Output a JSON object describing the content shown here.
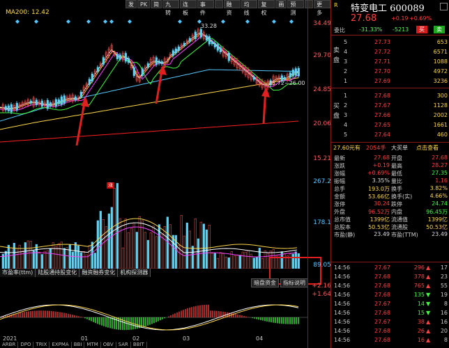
{
  "toolbar": {
    "buttons": [
      "发",
      "PK",
      "简",
      "九转",
      "连板",
      "事件",
      "",
      "融资",
      "均线",
      "复权",
      "画",
      "预测",
      "",
      "更多"
    ]
  },
  "chart": {
    "ma_label": "MA200: 12.42",
    "peak_label": "33.28",
    "range_label": "25.72~26.00",
    "zhang_badge": "涨",
    "price_ticks": [
      "34.49",
      "29.70",
      "24.85",
      "20.06",
      "15.21"
    ],
    "volume_ticks": [
      "267.2",
      "178.1",
      "89.05"
    ],
    "macd_ticks": [
      "+2.16",
      "+1.64"
    ],
    "indicator_tabs": [
      "市盈率(ttm)",
      "陆股通持股变化",
      "融资融券变化",
      "机构探测器"
    ],
    "sub_buttons": [
      "暗盘资金",
      "指标说明"
    ],
    "bottom_tabs": [
      "ARBR",
      "DPO",
      "TRIX",
      "EXPMA",
      "BBI",
      "MTM",
      "OBV",
      "SAR",
      "BBIT"
    ],
    "months": [
      "2021",
      "01",
      "02",
      "03",
      "04"
    ],
    "colors": {
      "up": "#ff4040",
      "down": "#4fd8ff",
      "ma5": "#ffffff",
      "ma10": "#ffd84a",
      "ma20": "#ff40ff",
      "ma60": "#40ff40",
      "ma200": "#ff2020"
    }
  },
  "quote": {
    "market_tag": "R",
    "name": "特变电工 600089",
    "price": "27.68",
    "change": "+0.19",
    "change_pct": "+0.69%",
    "weibi_label": "委比",
    "weibi": "-31.33%",
    "weicha": "-5213",
    "buy_btn": "买",
    "sell_btn": "卖",
    "ask_side": "卖盘",
    "bid_side": "买盘",
    "asks": [
      {
        "level": "5",
        "price": "27.73",
        "vol": "653"
      },
      {
        "level": "4",
        "price": "27.72",
        "vol": "6571"
      },
      {
        "level": "3",
        "price": "27.71",
        "vol": "1088"
      },
      {
        "level": "2",
        "price": "27.70",
        "vol": "4972"
      },
      {
        "level": "1",
        "price": "27.69",
        "vol": "3236"
      }
    ],
    "bids": [
      {
        "level": "1",
        "price": "27.68",
        "vol": "300"
      },
      {
        "level": "2",
        "price": "27.67",
        "vol": "1128"
      },
      {
        "level": "3",
        "price": "27.66",
        "vol": "2002"
      },
      {
        "level": "4",
        "price": "27.65",
        "vol": "1661"
      },
      {
        "level": "5",
        "price": "27.64",
        "vol": "460"
      }
    ],
    "links": {
      "last": "27.60元有",
      "vol": "2054手",
      "big": "大买单",
      "click": "点击查看"
    },
    "stats": [
      {
        "k1": "最新",
        "v1": "27.68",
        "c1": "red",
        "k2": "开盘",
        "v2": "27.68",
        "c2": "red"
      },
      {
        "k1": "涨跌",
        "v1": "+0.19",
        "c1": "red",
        "k2": "最高",
        "v2": "28.27",
        "c2": "red"
      },
      {
        "k1": "涨幅",
        "v1": "+0.69%",
        "c1": "red",
        "k2": "最低",
        "v2": "27.35",
        "c2": "grn"
      },
      {
        "k1": "振幅",
        "v1": "3.35%",
        "c1": "wht",
        "k2": "量比",
        "v2": "1.16",
        "c2": "red"
      },
      {
        "k1": "总手",
        "v1": "193.0万",
        "c1": "yel",
        "k2": "换手",
        "v2": "3.82%",
        "c2": "yel"
      },
      {
        "k1": "金额",
        "v1": "53.66亿",
        "c1": "yel",
        "k2": "换手(实)",
        "v2": "4.66%",
        "c2": "yel"
      },
      {
        "k1": "涨停",
        "v1": "30.24",
        "c1": "red",
        "k2": "跌停",
        "v2": "24.74",
        "c2": "grn"
      },
      {
        "k1": "外盘",
        "v1": "96.52万",
        "c1": "red",
        "k2": "内盘",
        "v2": "96.45万",
        "c2": "grn"
      },
      {
        "k1": "总市值",
        "v1": "1399亿",
        "c1": "yel",
        "k2": "流通值",
        "v2": "1399亿",
        "c2": "yel"
      },
      {
        "k1": "总股本",
        "v1": "50.53亿",
        "c1": "yel",
        "k2": "流通股",
        "v2": "50.53亿",
        "c2": "yel"
      },
      {
        "k1": "市盈(静)",
        "v1": "23.49",
        "c1": "wht",
        "k2": "市盈(TTM)",
        "v2": "23.49",
        "c2": "wht"
      }
    ],
    "ticks": [
      {
        "t": "14:56",
        "p": "27.67",
        "v": "296",
        "dir": "up",
        "n": "17"
      },
      {
        "t": "14:56",
        "p": "27.68",
        "v": "378",
        "dir": "up",
        "n": "23"
      },
      {
        "t": "14:56",
        "p": "27.68",
        "v": "765",
        "dir": "up",
        "n": "55"
      },
      {
        "t": "14:56",
        "p": "27.68",
        "v": "135",
        "dir": "down",
        "n": "19"
      },
      {
        "t": "14:56",
        "p": "27.67",
        "v": "14",
        "dir": "down",
        "n": "8"
      },
      {
        "t": "14:56",
        "p": "27.68",
        "v": "15",
        "dir": "down",
        "n": "16"
      },
      {
        "t": "14:56",
        "p": "27.67",
        "v": "38",
        "dir": "up",
        "n": "16"
      },
      {
        "t": "14:56",
        "p": "27.68",
        "v": "26",
        "dir": "up",
        "n": "20"
      },
      {
        "t": "14:56",
        "p": "27.68",
        "v": "16",
        "dir": "up",
        "n": "8"
      }
    ]
  }
}
